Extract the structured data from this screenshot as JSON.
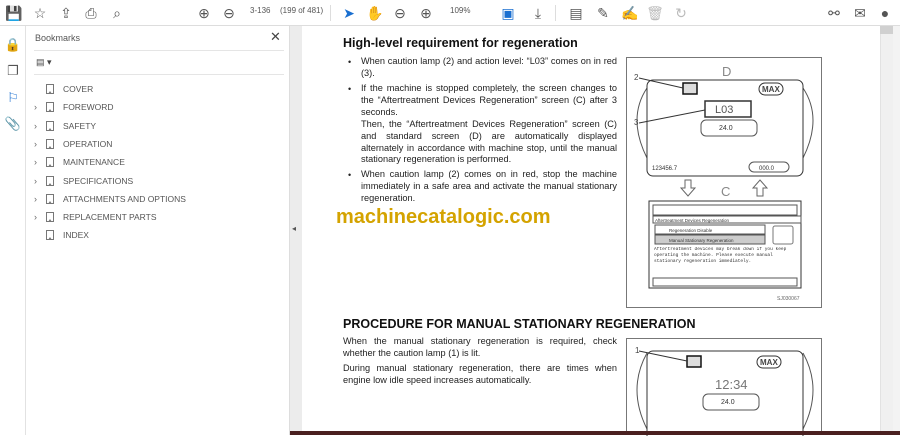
{
  "toolbar": {
    "page_label": "3-136",
    "page_count": "(199 of 481)",
    "zoom": "109%",
    "icons": [
      "save-icon",
      "star-icon",
      "cloud-upload-icon",
      "print-icon",
      "find-icon",
      "page-up-icon",
      "page-down-icon",
      "select-cursor-icon",
      "hand-icon",
      "zoom-out-icon",
      "zoom-in-icon",
      "page-fit-icon",
      "scroll-mode-icon",
      "comment-icon",
      "pen-icon",
      "sign-icon",
      "delete-icon",
      "redo-icon",
      "link-icon",
      "email-icon",
      "account-icon"
    ]
  },
  "rail": {
    "icons": [
      "lock-icon",
      "pages-icon",
      "bookmark-icon",
      "attachment-icon"
    ]
  },
  "bookmarks": {
    "title": "Bookmarks",
    "close": "✕",
    "items": [
      {
        "label": "COVER",
        "expandable": false
      },
      {
        "label": "FOREWORD",
        "expandable": true
      },
      {
        "label": "SAFETY",
        "expandable": true
      },
      {
        "label": "OPERATION",
        "expandable": true
      },
      {
        "label": "MAINTENANCE",
        "expandable": true
      },
      {
        "label": "SPECIFICATIONS",
        "expandable": true
      },
      {
        "label": "ATTACHMENTS AND OPTIONS",
        "expandable": true
      },
      {
        "label": "REPLACEMENT PARTS",
        "expandable": true
      },
      {
        "label": "INDEX",
        "expandable": false
      }
    ]
  },
  "doc": {
    "heading1": "High-level requirement for regeneration",
    "bullets": [
      "When caution lamp (2) and action level: “L03” comes on in red (3).",
      "If the machine is stopped completely, the screen changes to the “Aftertreatment Devices Regeneration” screen (C) after 3 seconds.",
      "Then, the “Aftertreatment Devices Regeneration” screen (C) and standard screen (D) are automatically displayed alternately in accordance with machine stop, until the manual stationary regeneration is performed.",
      "When caution lamp (2) comes on in red, stop the machine immediately in a safe area and activate the manual stationary regeneration."
    ],
    "heading2": "PROCEDURE FOR MANUAL STATIONARY REGENERATION",
    "para1": "When the manual stationary regeneration is required, check whether the caution lamp (1) is lit.",
    "para2": "During manual stationary regeneration, there are times when engine low idle speed increases automatically.",
    "watermark": "machinecatalogic.com",
    "fig1": {
      "label_d": "D",
      "label_c": "C",
      "callout2": "2",
      "callout3": "3",
      "level": "L03",
      "max": "MAX",
      "temp": "24.0",
      "hours": "123456.7",
      "odo": "000.0",
      "screen_title": "Aftertreatment Devices Regeneration",
      "opt1": "Regeneration Disable",
      "opt2": "Manual Stationary Regeneration",
      "msg": "Aftertreatment devices may break down if you keep operating the machine. Please execute manual stationary regeneration immediately.",
      "code": "SJ030067"
    },
    "fig2": {
      "callout1": "1",
      "clock": "12:34",
      "max": "MAX",
      "temp": "24.0"
    }
  }
}
